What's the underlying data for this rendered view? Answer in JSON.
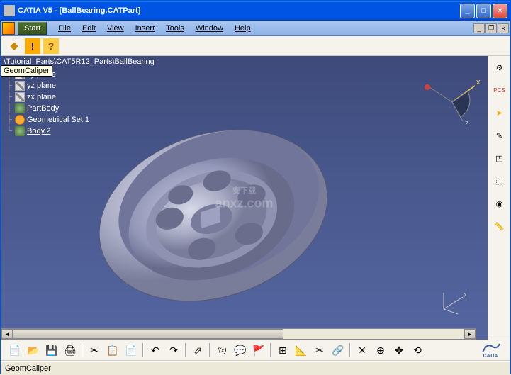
{
  "window": {
    "title": "CATIA V5 - [BallBearing.CATPart]",
    "tooltip": "GeomCaliper"
  },
  "menus": {
    "start": "Start",
    "items": [
      "File",
      "Edit",
      "View",
      "Insert",
      "Tools",
      "Window",
      "Help"
    ]
  },
  "path": "\\Tutorial_Parts\\CAT5R12_Parts\\BallBearing",
  "tree": [
    {
      "label": "xy plane",
      "icon": "plane"
    },
    {
      "label": "yz plane",
      "icon": "plane"
    },
    {
      "label": "zx plane",
      "icon": "plane"
    },
    {
      "label": "PartBody",
      "icon": "body"
    },
    {
      "label": "Geometrical Set.1",
      "icon": "geomset"
    },
    {
      "label": "Body.2",
      "icon": "body",
      "underlined": true
    }
  ],
  "compass": {
    "x_label": "x",
    "z_label": "z"
  },
  "axis": {
    "label": "x"
  },
  "right_tools": [
    {
      "name": "settings-icon",
      "glyph": "⚙"
    },
    {
      "name": "pcs-icon",
      "glyph": "PCS",
      "color": "#cc3333"
    },
    {
      "name": "select-arrow-icon",
      "glyph": "➤",
      "color": "#ffaa00"
    },
    {
      "name": "edit-icon",
      "glyph": "✎"
    },
    {
      "name": "compass-icon",
      "glyph": "◳"
    },
    {
      "name": "view-icon",
      "glyph": "⬚"
    },
    {
      "name": "material-icon",
      "glyph": "◉"
    },
    {
      "name": "measure-icon",
      "glyph": "📏"
    }
  ],
  "bottom_tools": [
    {
      "name": "new-icon",
      "glyph": "📄"
    },
    {
      "name": "open-icon",
      "glyph": "📂"
    },
    {
      "name": "save-icon",
      "glyph": "💾"
    },
    {
      "name": "print-icon",
      "glyph": "🖨"
    },
    {
      "name": "sep"
    },
    {
      "name": "cut-icon",
      "glyph": "✂"
    },
    {
      "name": "copy-icon",
      "glyph": "📋"
    },
    {
      "name": "paste-icon",
      "glyph": "📄"
    },
    {
      "name": "sep"
    },
    {
      "name": "undo-icon",
      "glyph": "↶"
    },
    {
      "name": "redo-icon",
      "glyph": "↷"
    },
    {
      "name": "sep"
    },
    {
      "name": "pointer-icon",
      "glyph": "⬀"
    },
    {
      "name": "sep"
    },
    {
      "name": "formula-icon",
      "glyph": "f(x)"
    },
    {
      "name": "balloon-icon",
      "glyph": "💬"
    },
    {
      "name": "flag-icon",
      "glyph": "🚩"
    },
    {
      "name": "sep"
    },
    {
      "name": "grid-icon",
      "glyph": "⊞"
    },
    {
      "name": "ruler-icon",
      "glyph": "📐"
    },
    {
      "name": "clip-icon",
      "glyph": "✂"
    },
    {
      "name": "link-icon",
      "glyph": "🔗"
    },
    {
      "name": "sep"
    },
    {
      "name": "swallow-icon",
      "glyph": "✕"
    },
    {
      "name": "fit-icon",
      "glyph": "⊕"
    },
    {
      "name": "pan-icon",
      "glyph": "✥"
    },
    {
      "name": "rotate-icon",
      "glyph": "⟲"
    }
  ],
  "logo": {
    "text": "CATIA"
  },
  "status": {
    "text": "GeomCaliper"
  },
  "watermark": {
    "line1": "安下载",
    "line2": "anxz.com"
  }
}
